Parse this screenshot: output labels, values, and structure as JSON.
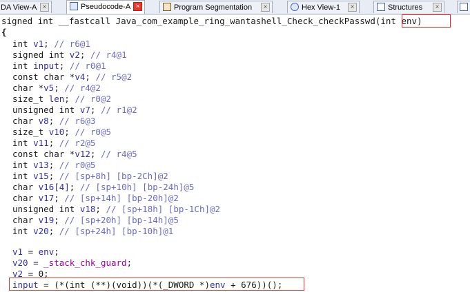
{
  "tabs": [
    {
      "label": "DA View-A",
      "icon": "disassembly-view-icon",
      "active": false
    },
    {
      "label": "Pseudocode-A",
      "icon": "pseudocode-icon",
      "active": true
    },
    {
      "label": "Program Segmentation",
      "icon": "segments-icon",
      "active": false
    },
    {
      "label": "Hex View-1",
      "icon": "hex-view-icon",
      "active": false
    },
    {
      "label": "Structures",
      "icon": "structures-icon",
      "active": false
    }
  ],
  "close_glyph": "×",
  "colors": {
    "keyword": "#1a1a1a",
    "variable": "#3030a0",
    "comment": "#6a6ac0",
    "global": "#a000a0",
    "highlight": "#e0302a"
  },
  "code": {
    "signature_prefix": "signed int __fastcall Java_com_example_ring_wantashell_Check_checkPasswd",
    "signature_param": "(int env)",
    "open_brace": "{",
    "decls": [
      {
        "type": "int ",
        "name": "v1",
        "cmt": "// r6@1"
      },
      {
        "type": "signed int ",
        "name": "v2",
        "cmt": "// r4@1"
      },
      {
        "type": "int ",
        "name": "input",
        "cmt": "// r0@1"
      },
      {
        "type": "const char *",
        "name": "v4",
        "cmt": "// r5@2"
      },
      {
        "type": "char *",
        "name": "v5",
        "cmt": "// r4@2"
      },
      {
        "type": "size_t ",
        "name": "len",
        "cmt": "// r0@2"
      },
      {
        "type": "unsigned int ",
        "name": "v7",
        "cmt": "// r1@2"
      },
      {
        "type": "char ",
        "name": "v8",
        "cmt": "// r6@3"
      },
      {
        "type": "size_t ",
        "name": "v10",
        "cmt": "// r0@5"
      },
      {
        "type": "int ",
        "name": "v11",
        "cmt": "// r2@5"
      },
      {
        "type": "const char *",
        "name": "v12",
        "cmt": "// r4@5"
      },
      {
        "type": "int ",
        "name": "v13",
        "cmt": "// r0@5"
      },
      {
        "type": "int ",
        "name": "v15",
        "cmt": "// [sp+8h] [bp-2Ch]@2"
      },
      {
        "type": "char ",
        "name": "v16[4]",
        "cmt": "// [sp+10h] [bp-24h]@5"
      },
      {
        "type": "char ",
        "name": "v17",
        "cmt": "// [sp+14h] [bp-20h]@2"
      },
      {
        "type": "unsigned int ",
        "name": "v18",
        "cmt": "// [sp+18h] [bp-1Ch]@2"
      },
      {
        "type": "char ",
        "name": "v19",
        "cmt": "// [sp+20h] [bp-14h]@5"
      },
      {
        "type": "int ",
        "name": "v20",
        "cmt": "// [sp+24h] [bp-10h]@1"
      }
    ],
    "stmt1": {
      "lhs": "v1",
      "op": " = ",
      "rhs": "env",
      "end": ";"
    },
    "stmt2": {
      "lhs": "v20",
      "op": " = ",
      "rhs": "_stack_chk_guard",
      "end": ";"
    },
    "stmt3": {
      "lhs": "v2",
      "op": " = ",
      "rhs": "0",
      "end": ";"
    },
    "stmt4": {
      "lhs": "input",
      "op": " = ",
      "p1": "(*(int (**)(void))(*(_DWORD *)",
      "var": "env",
      "p2": " + 676))();"
    }
  }
}
